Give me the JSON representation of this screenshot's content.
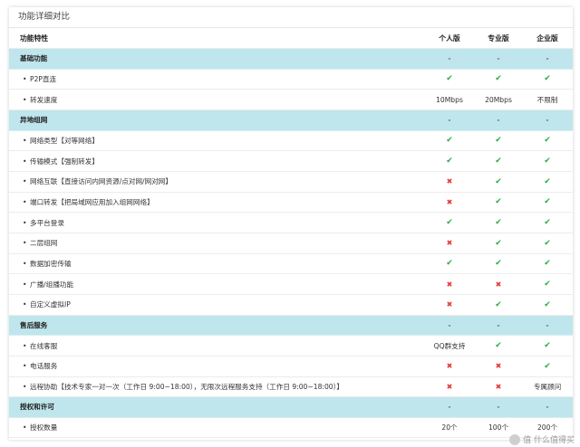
{
  "title": "功能详细对比",
  "columns": [
    "功能特性",
    "个人版",
    "专业版",
    "企业版"
  ],
  "rows": [
    {
      "type": "section",
      "label": "基础功能",
      "values": [
        "-",
        "-",
        "-"
      ]
    },
    {
      "type": "item",
      "label": "P2P直连",
      "values": [
        "check",
        "check",
        "check"
      ]
    },
    {
      "type": "item",
      "label": "转发速度",
      "values": [
        "10Mbps",
        "20Mbps",
        "不限制"
      ]
    },
    {
      "type": "section",
      "label": "异地组网",
      "values": [
        "-",
        "-",
        "-"
      ]
    },
    {
      "type": "item",
      "label": "网络类型【对等网络】",
      "values": [
        "check",
        "check",
        "check"
      ]
    },
    {
      "type": "item",
      "label": "传输模式【强制转发】",
      "values": [
        "check",
        "check",
        "check"
      ]
    },
    {
      "type": "item",
      "label": "网络互联【直接访问内网资源/点对网/网对网】",
      "values": [
        "cross",
        "check",
        "check"
      ]
    },
    {
      "type": "item",
      "label": "端口转发【把局域网应用加入组网网络】",
      "values": [
        "cross",
        "check",
        "check"
      ]
    },
    {
      "type": "item",
      "label": "多平台登录",
      "values": [
        "check",
        "check",
        "check"
      ]
    },
    {
      "type": "item",
      "label": "二层组网",
      "values": [
        "cross",
        "check",
        "check"
      ]
    },
    {
      "type": "item",
      "label": "数据加密传输",
      "values": [
        "check",
        "check",
        "check"
      ]
    },
    {
      "type": "item",
      "label": "广播/组播功能",
      "values": [
        "cross",
        "cross",
        "check"
      ]
    },
    {
      "type": "item",
      "label": "自定义虚拟IP",
      "values": [
        "cross",
        "check",
        "check"
      ]
    },
    {
      "type": "section",
      "label": "售后服务",
      "values": [
        "-",
        "-",
        "-"
      ]
    },
    {
      "type": "item",
      "label": "在线客服",
      "values": [
        "QQ群支持",
        "check",
        "check"
      ]
    },
    {
      "type": "item",
      "label": "电话服务",
      "values": [
        "cross",
        "cross",
        "check"
      ]
    },
    {
      "type": "item",
      "label": "远程协助【技术专家一对一次（工作日 9:00~18:00），无限次远程服务支持（工作日 9:00~18:00）】",
      "values": [
        "cross",
        "cross",
        "专属顾问"
      ]
    },
    {
      "type": "section",
      "label": "授权和许可",
      "values": [
        "-",
        "-",
        "-"
      ]
    },
    {
      "type": "item",
      "label": "授权数量",
      "values": [
        "20个",
        "100个",
        "200个"
      ]
    }
  ],
  "symbols": {
    "check": "✔",
    "cross": "✖",
    "bullet": "•"
  },
  "colors": {
    "section_bg": "#bfe6ec",
    "check": "#2eaa4a",
    "cross": "#e23b3b"
  },
  "watermark": {
    "text": "值 什么值得买"
  }
}
